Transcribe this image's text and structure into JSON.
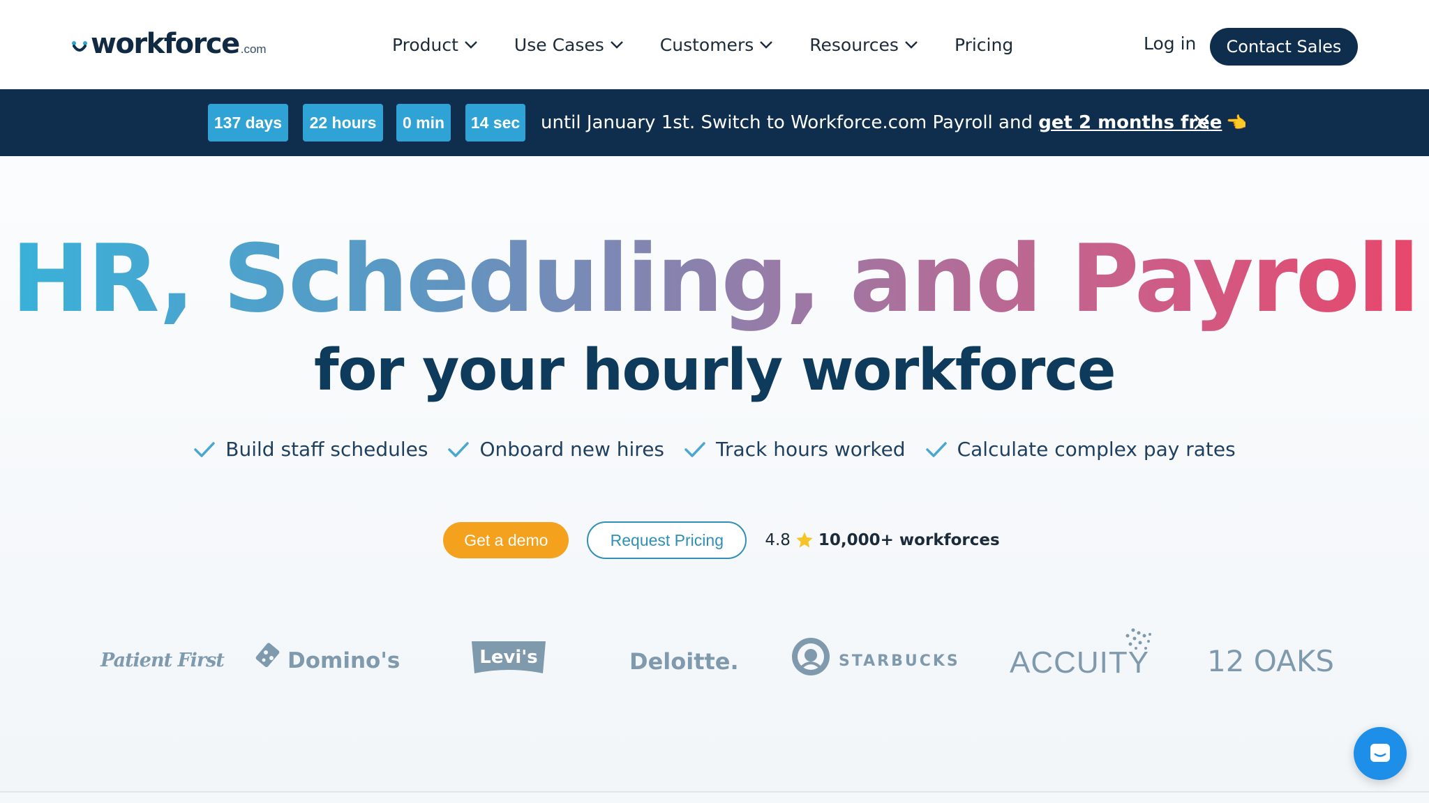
{
  "header": {
    "logo_word": "workforce",
    "logo_tld": ".com",
    "nav": [
      {
        "label": "Product",
        "dropdown": true
      },
      {
        "label": "Use Cases",
        "dropdown": true
      },
      {
        "label": "Customers",
        "dropdown": true
      },
      {
        "label": "Resources",
        "dropdown": true
      },
      {
        "label": "Pricing",
        "dropdown": false
      }
    ],
    "login_label": "Log in",
    "contact_label": "Contact Sales"
  },
  "banner": {
    "countdown": [
      "137 days",
      "22 hours",
      "0 min",
      "14 sec"
    ],
    "text": "until January 1st. Switch to Workforce.com Payroll and ",
    "link_text": "get 2 months free",
    "emoji": "👈",
    "close_icon": "close-icon"
  },
  "hero": {
    "headline": "HR, Scheduling, and Payroll",
    "subheadline": "for your hourly workforce",
    "features": [
      "Build staff schedules",
      "Onboard new hires",
      "Track hours worked",
      "Calculate complex pay rates"
    ],
    "cta_demo": "Get a demo",
    "cta_pricing": "Request Pricing",
    "rating_value": "4.8",
    "rating_count": "10,000+ workforces"
  },
  "customers": [
    "Patient First",
    "Domino's",
    "Levi's",
    "Deloitte.",
    "STARBUCKS",
    "ACCUITY",
    "12 OAKS"
  ],
  "colors": {
    "navy": "#0f2e4d",
    "accent_blue": "#2fa3d6",
    "orange": "#f4a11d",
    "gradient_start": "#38b2d9",
    "gradient_end": "#e9466a"
  }
}
